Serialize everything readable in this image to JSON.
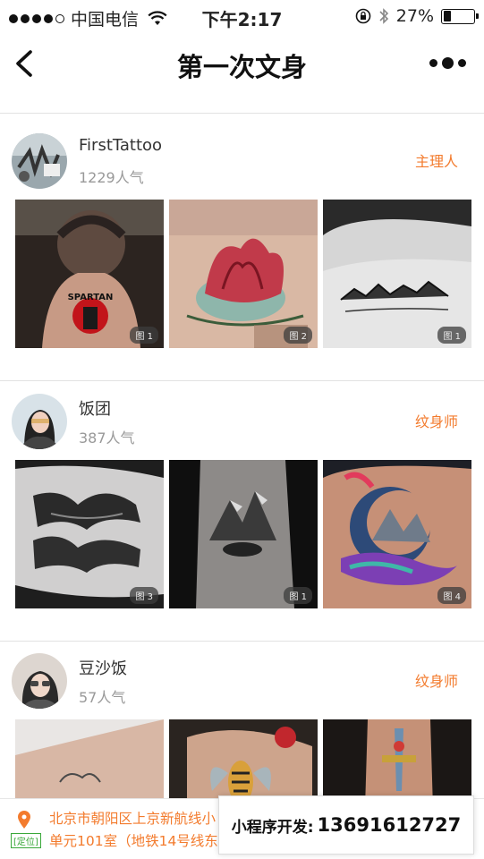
{
  "status_bar": {
    "carrier": "中国电信",
    "time": "下午2:17",
    "battery_text": "27%",
    "battery_level": 0.27,
    "signal_bars_filled": 4,
    "signal_bars_total": 5
  },
  "nav": {
    "title": "第一次文身"
  },
  "artists": [
    {
      "name": "FirstTattoo",
      "popularity": "1229人气",
      "role": "主理人",
      "photos": [
        {
          "tag": "图 1"
        },
        {
          "tag": "图 2"
        },
        {
          "tag": "图 1"
        }
      ]
    },
    {
      "name": "饭团",
      "popularity": "387人气",
      "role": "纹身师",
      "photos": [
        {
          "tag": "图 3"
        },
        {
          "tag": "图 1"
        },
        {
          "tag": "图 4"
        }
      ]
    },
    {
      "name": "豆沙饭",
      "popularity": "57人气",
      "role": "纹身师",
      "photos": [
        {},
        {},
        {}
      ]
    }
  ],
  "footer": {
    "location_label": "[定位]",
    "address_line1": "北京市朝阳区上京新航线小",
    "address_line2": "单元101室（地铁14号线东",
    "promo_label": "小程序开发:",
    "promo_phone": "13691612727"
  },
  "colors": {
    "accent": "#f37b2d",
    "location_green": "#3aa83a"
  }
}
